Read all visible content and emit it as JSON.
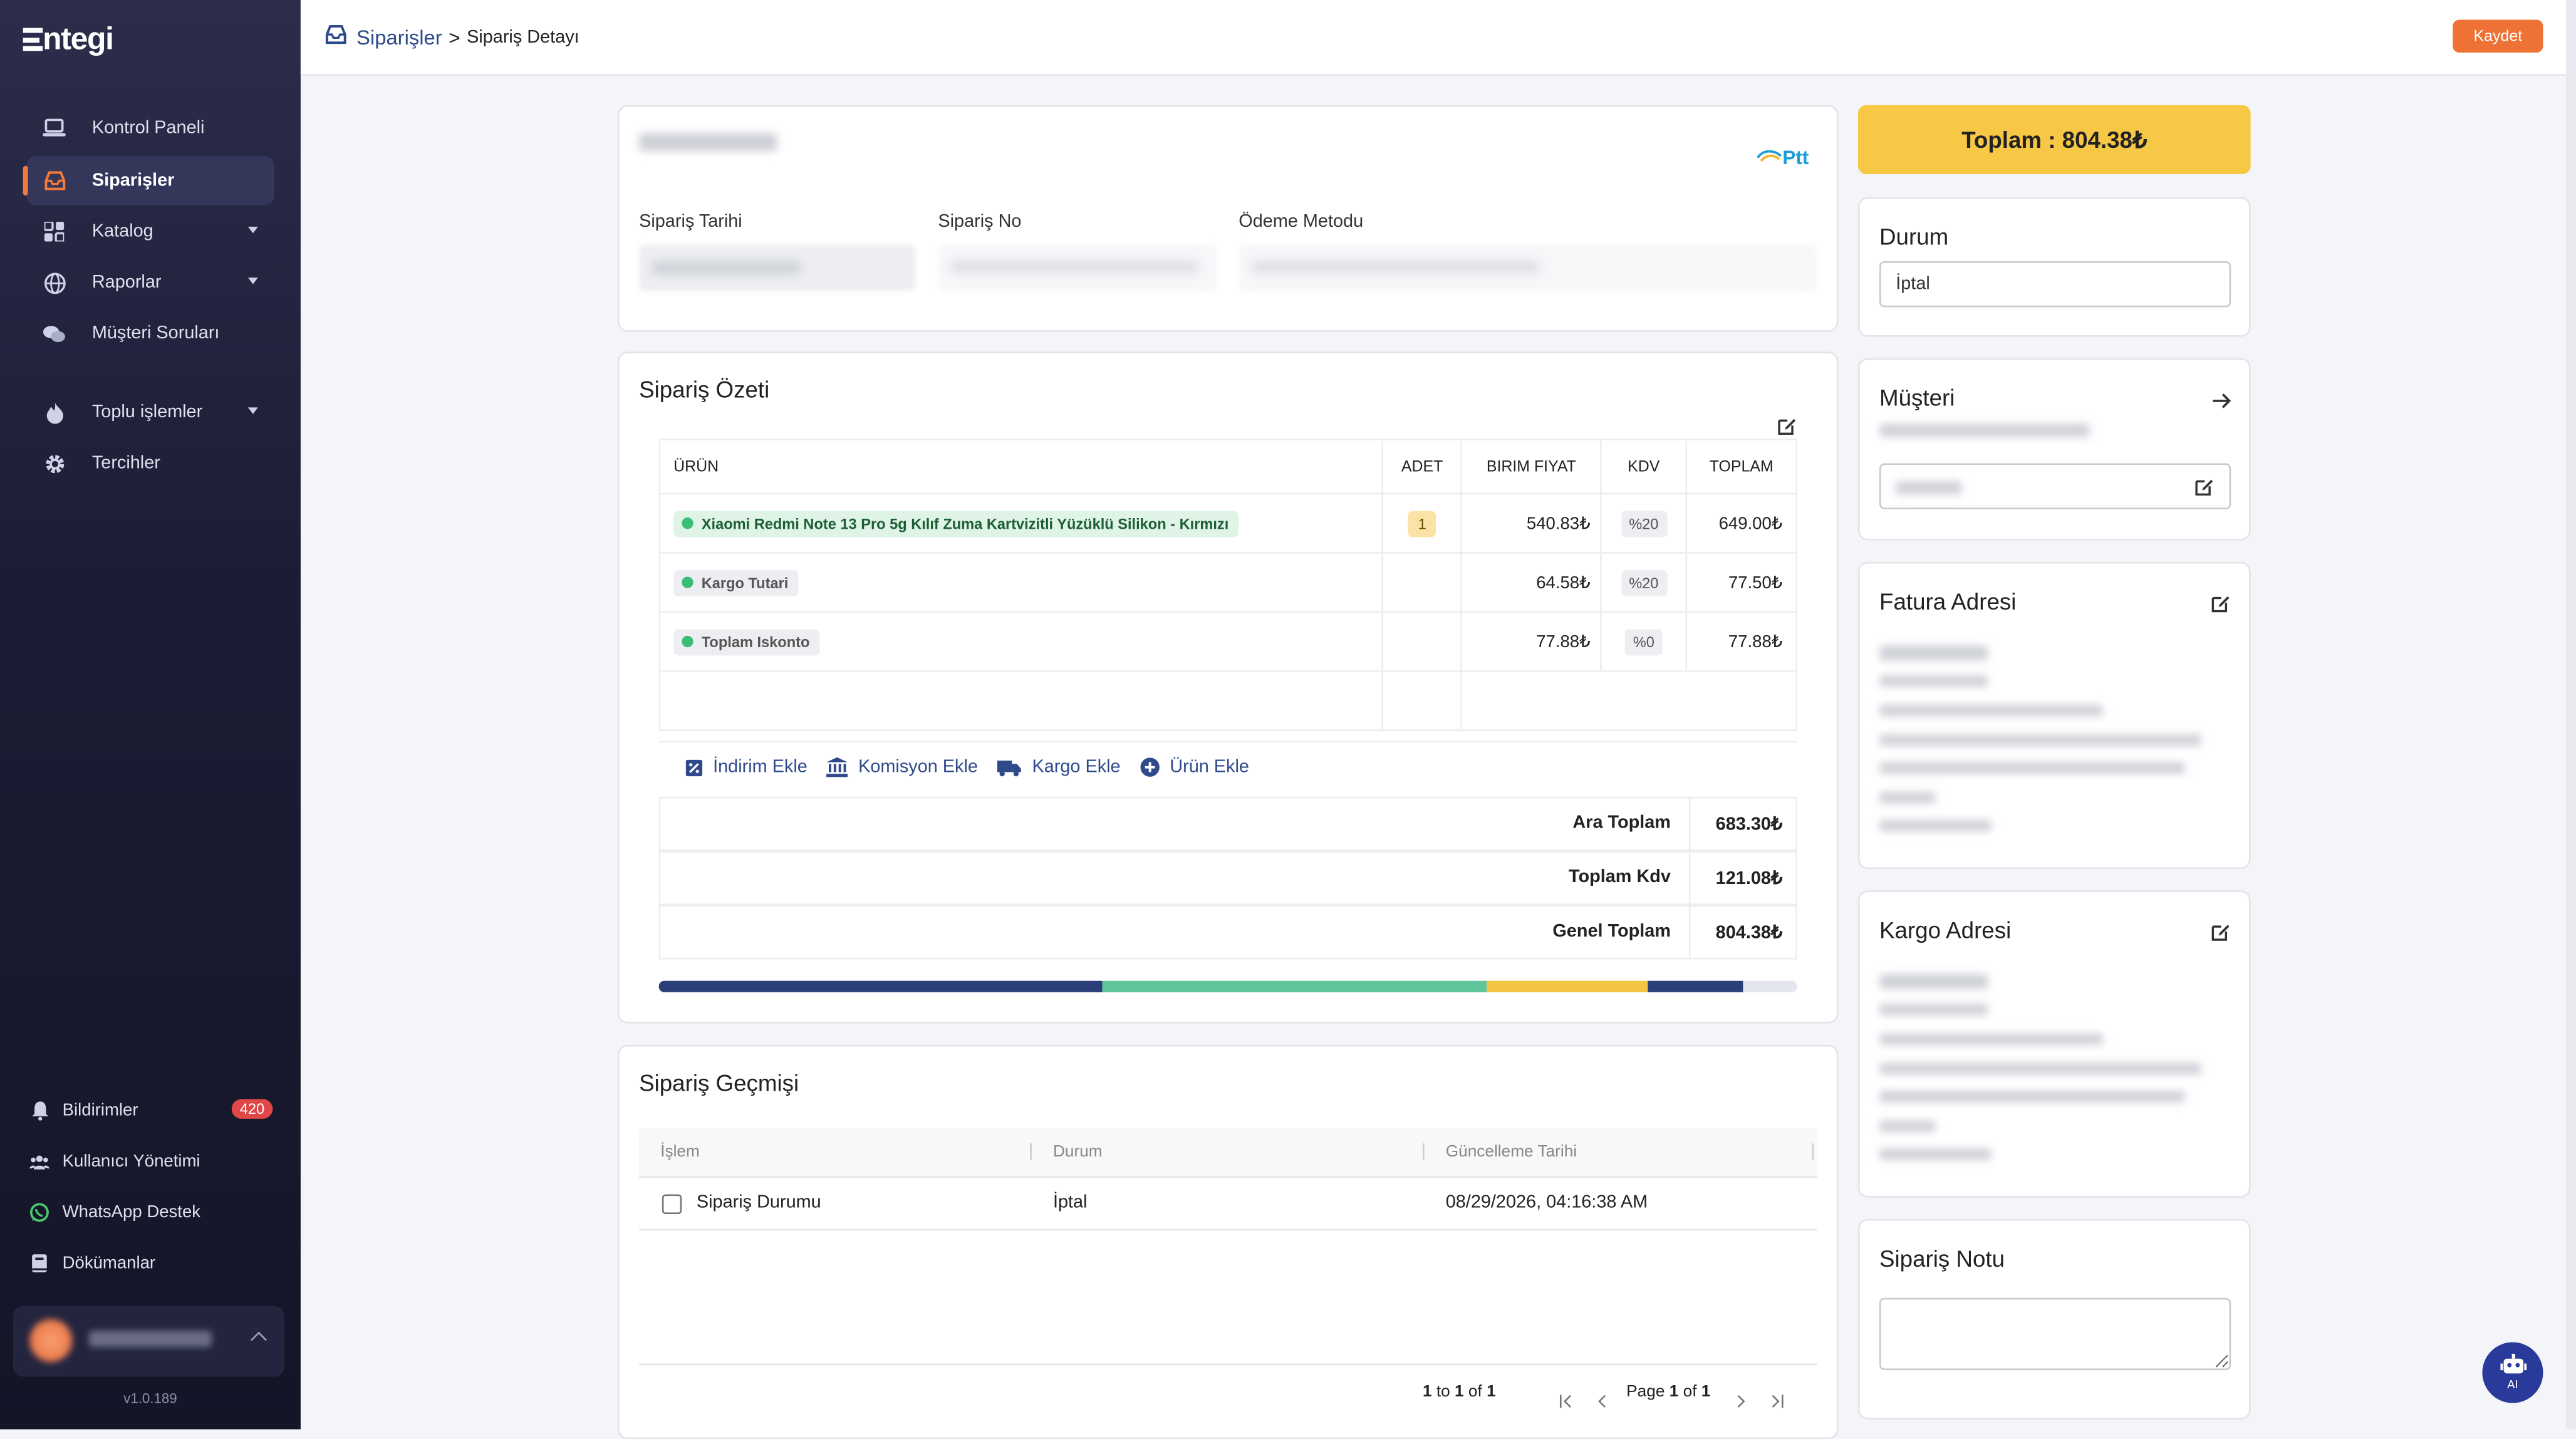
{
  "app": {
    "logo": "ntegi",
    "version": "v1.0.189"
  },
  "sidebar": {
    "items": [
      {
        "label": "Kontrol Paneli",
        "icon": "laptop-icon"
      },
      {
        "label": "Siparişler",
        "icon": "inbox-icon",
        "active": true
      },
      {
        "label": "Katalog",
        "icon": "grid-icon"
      },
      {
        "label": "Raporlar",
        "icon": "globe-icon"
      },
      {
        "label": "Müşteri Soruları",
        "icon": "chat-icon"
      },
      {
        "label": "Toplu işlemler",
        "icon": "fire-icon"
      },
      {
        "label": "Tercihler",
        "icon": "gear-icon"
      }
    ],
    "bottom": [
      {
        "label": "Bildirimler",
        "icon": "bell-icon",
        "badge": "420"
      },
      {
        "label": "Kullanıcı Yönetimi",
        "icon": "users-icon"
      },
      {
        "label": "WhatsApp Destek",
        "icon": "whatsapp-icon"
      },
      {
        "label": "Dökümanlar",
        "icon": "book-icon"
      }
    ]
  },
  "header": {
    "breadcrumb_root": "Siparişler",
    "breadcrumb_sep": ">",
    "breadcrumb_current": "Sipariş Detayı",
    "save_label": "Kaydet"
  },
  "order_info": {
    "marketplace": "Ptt",
    "date_label": "Sipariş Tarihi",
    "no_label": "Sipariş No",
    "payment_label": "Ödeme Metodu"
  },
  "summary": {
    "title": "Sipariş Özeti",
    "columns": [
      "ÜRÜN",
      "ADET",
      "BIRIM FIYAT",
      "KDV",
      "TOPLAM"
    ],
    "rows": [
      {
        "product": "Xiaomi Redmi Note 13 Pro 5g Kılıf Zuma Kartvizitli Yüzüklü Silikon - Kırmızı",
        "qty": "1",
        "unit_price": "540.83₺",
        "kdv": "%20",
        "total": "649.00₺"
      },
      {
        "product": "Kargo Tutari",
        "qty": "",
        "unit_price": "64.58₺",
        "kdv": "%20",
        "total": "77.50₺"
      },
      {
        "product": "Toplam Iskonto",
        "qty": "",
        "unit_price": "77.88₺",
        "kdv": "%0",
        "total": "77.88₺"
      }
    ],
    "actions": [
      "İndirim Ekle",
      "Komisyon Ekle",
      "Kargo Ekle",
      "Ürün Ekle"
    ],
    "subtotal_label": "Ara Toplam",
    "subtotal": "683.30₺",
    "tax_label": "Toplam Kdv",
    "tax": "121.08₺",
    "grand_label": "Genel Toplam",
    "grand": "804.38₺",
    "progress": [
      {
        "fraction": 0.39,
        "color": "#2c3e7a"
      },
      {
        "fraction": 0.338,
        "color": "#5fc49a"
      },
      {
        "fraction": 0.14,
        "color": "#f4c544"
      },
      {
        "fraction": 0.085,
        "color": "#2c3e7a"
      }
    ]
  },
  "history": {
    "title": "Sipariş Geçmişi",
    "columns": [
      "İşlem",
      "Durum",
      "Güncelleme Tarihi"
    ],
    "rows": [
      {
        "action": "Sipariş Durumu",
        "status": "İptal",
        "date": "08/29/2026, 04:16:38 AM"
      }
    ],
    "pager_from": "1",
    "pager_to_word": "to",
    "pager_to": "1",
    "pager_of_word": "of",
    "pager_total": "1",
    "page_word": "Page",
    "page_current": "1",
    "page_of_word": "of",
    "page_total": "1"
  },
  "right": {
    "total_label": "Toplam : 804.38₺",
    "status_title": "Durum",
    "status_value": "İptal",
    "customer_title": "Müşteri",
    "invoice_title": "Fatura Adresi",
    "shipping_title": "Kargo Adresi",
    "note_title": "Sipariş Notu",
    "ai_label": "AI"
  },
  "colors": {
    "accent": "#ee7136",
    "brand": "#2e4a8a",
    "total_bg": "#f6c845"
  }
}
